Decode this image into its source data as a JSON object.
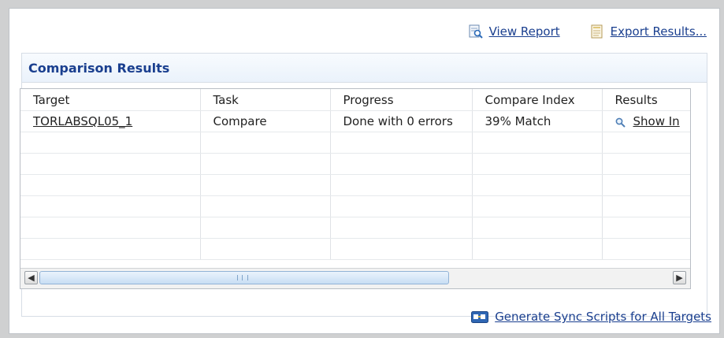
{
  "toolbar": {
    "view_report": "View Report",
    "export_results": "Export Results..."
  },
  "section": {
    "title": "Comparison Results"
  },
  "table": {
    "columns": [
      "Target",
      "Task",
      "Progress",
      "Compare Index",
      "Results"
    ],
    "rows": [
      {
        "target": "TORLABSQL05_1",
        "task": "Compare",
        "progress": "Done with 0 errors",
        "compare_index": "39% Match",
        "results": "Show In"
      }
    ]
  },
  "scrollbar": {
    "grip": "III"
  },
  "footer": {
    "generate_sync": "Generate Sync Scripts for All Targets"
  },
  "colors": {
    "link": "#1a3f8f",
    "header_bg": "#eaf2fb",
    "border": "#b9bec5"
  }
}
